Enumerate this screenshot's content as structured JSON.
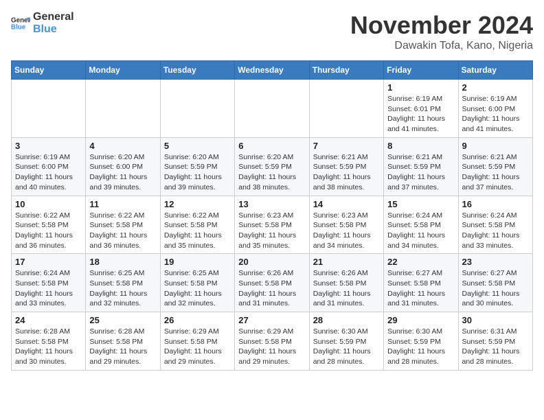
{
  "logo": {
    "line1": "General",
    "line2": "Blue"
  },
  "title": "November 2024",
  "location": "Dawakin Tofa, Kano, Nigeria",
  "weekdays": [
    "Sunday",
    "Monday",
    "Tuesday",
    "Wednesday",
    "Thursday",
    "Friday",
    "Saturday"
  ],
  "weeks": [
    [
      {
        "day": "",
        "info": ""
      },
      {
        "day": "",
        "info": ""
      },
      {
        "day": "",
        "info": ""
      },
      {
        "day": "",
        "info": ""
      },
      {
        "day": "",
        "info": ""
      },
      {
        "day": "1",
        "info": "Sunrise: 6:19 AM\nSunset: 6:01 PM\nDaylight: 11 hours\nand 41 minutes."
      },
      {
        "day": "2",
        "info": "Sunrise: 6:19 AM\nSunset: 6:00 PM\nDaylight: 11 hours\nand 41 minutes."
      }
    ],
    [
      {
        "day": "3",
        "info": "Sunrise: 6:19 AM\nSunset: 6:00 PM\nDaylight: 11 hours\nand 40 minutes."
      },
      {
        "day": "4",
        "info": "Sunrise: 6:20 AM\nSunset: 6:00 PM\nDaylight: 11 hours\nand 39 minutes."
      },
      {
        "day": "5",
        "info": "Sunrise: 6:20 AM\nSunset: 5:59 PM\nDaylight: 11 hours\nand 39 minutes."
      },
      {
        "day": "6",
        "info": "Sunrise: 6:20 AM\nSunset: 5:59 PM\nDaylight: 11 hours\nand 38 minutes."
      },
      {
        "day": "7",
        "info": "Sunrise: 6:21 AM\nSunset: 5:59 PM\nDaylight: 11 hours\nand 38 minutes."
      },
      {
        "day": "8",
        "info": "Sunrise: 6:21 AM\nSunset: 5:59 PM\nDaylight: 11 hours\nand 37 minutes."
      },
      {
        "day": "9",
        "info": "Sunrise: 6:21 AM\nSunset: 5:59 PM\nDaylight: 11 hours\nand 37 minutes."
      }
    ],
    [
      {
        "day": "10",
        "info": "Sunrise: 6:22 AM\nSunset: 5:58 PM\nDaylight: 11 hours\nand 36 minutes."
      },
      {
        "day": "11",
        "info": "Sunrise: 6:22 AM\nSunset: 5:58 PM\nDaylight: 11 hours\nand 36 minutes."
      },
      {
        "day": "12",
        "info": "Sunrise: 6:22 AM\nSunset: 5:58 PM\nDaylight: 11 hours\nand 35 minutes."
      },
      {
        "day": "13",
        "info": "Sunrise: 6:23 AM\nSunset: 5:58 PM\nDaylight: 11 hours\nand 35 minutes."
      },
      {
        "day": "14",
        "info": "Sunrise: 6:23 AM\nSunset: 5:58 PM\nDaylight: 11 hours\nand 34 minutes."
      },
      {
        "day": "15",
        "info": "Sunrise: 6:24 AM\nSunset: 5:58 PM\nDaylight: 11 hours\nand 34 minutes."
      },
      {
        "day": "16",
        "info": "Sunrise: 6:24 AM\nSunset: 5:58 PM\nDaylight: 11 hours\nand 33 minutes."
      }
    ],
    [
      {
        "day": "17",
        "info": "Sunrise: 6:24 AM\nSunset: 5:58 PM\nDaylight: 11 hours\nand 33 minutes."
      },
      {
        "day": "18",
        "info": "Sunrise: 6:25 AM\nSunset: 5:58 PM\nDaylight: 11 hours\nand 32 minutes."
      },
      {
        "day": "19",
        "info": "Sunrise: 6:25 AM\nSunset: 5:58 PM\nDaylight: 11 hours\nand 32 minutes."
      },
      {
        "day": "20",
        "info": "Sunrise: 6:26 AM\nSunset: 5:58 PM\nDaylight: 11 hours\nand 31 minutes."
      },
      {
        "day": "21",
        "info": "Sunrise: 6:26 AM\nSunset: 5:58 PM\nDaylight: 11 hours\nand 31 minutes."
      },
      {
        "day": "22",
        "info": "Sunrise: 6:27 AM\nSunset: 5:58 PM\nDaylight: 11 hours\nand 31 minutes."
      },
      {
        "day": "23",
        "info": "Sunrise: 6:27 AM\nSunset: 5:58 PM\nDaylight: 11 hours\nand 30 minutes."
      }
    ],
    [
      {
        "day": "24",
        "info": "Sunrise: 6:28 AM\nSunset: 5:58 PM\nDaylight: 11 hours\nand 30 minutes."
      },
      {
        "day": "25",
        "info": "Sunrise: 6:28 AM\nSunset: 5:58 PM\nDaylight: 11 hours\nand 29 minutes."
      },
      {
        "day": "26",
        "info": "Sunrise: 6:29 AM\nSunset: 5:58 PM\nDaylight: 11 hours\nand 29 minutes."
      },
      {
        "day": "27",
        "info": "Sunrise: 6:29 AM\nSunset: 5:58 PM\nDaylight: 11 hours\nand 29 minutes."
      },
      {
        "day": "28",
        "info": "Sunrise: 6:30 AM\nSunset: 5:59 PM\nDaylight: 11 hours\nand 28 minutes."
      },
      {
        "day": "29",
        "info": "Sunrise: 6:30 AM\nSunset: 5:59 PM\nDaylight: 11 hours\nand 28 minutes."
      },
      {
        "day": "30",
        "info": "Sunrise: 6:31 AM\nSunset: 5:59 PM\nDaylight: 11 hours\nand 28 minutes."
      }
    ]
  ]
}
